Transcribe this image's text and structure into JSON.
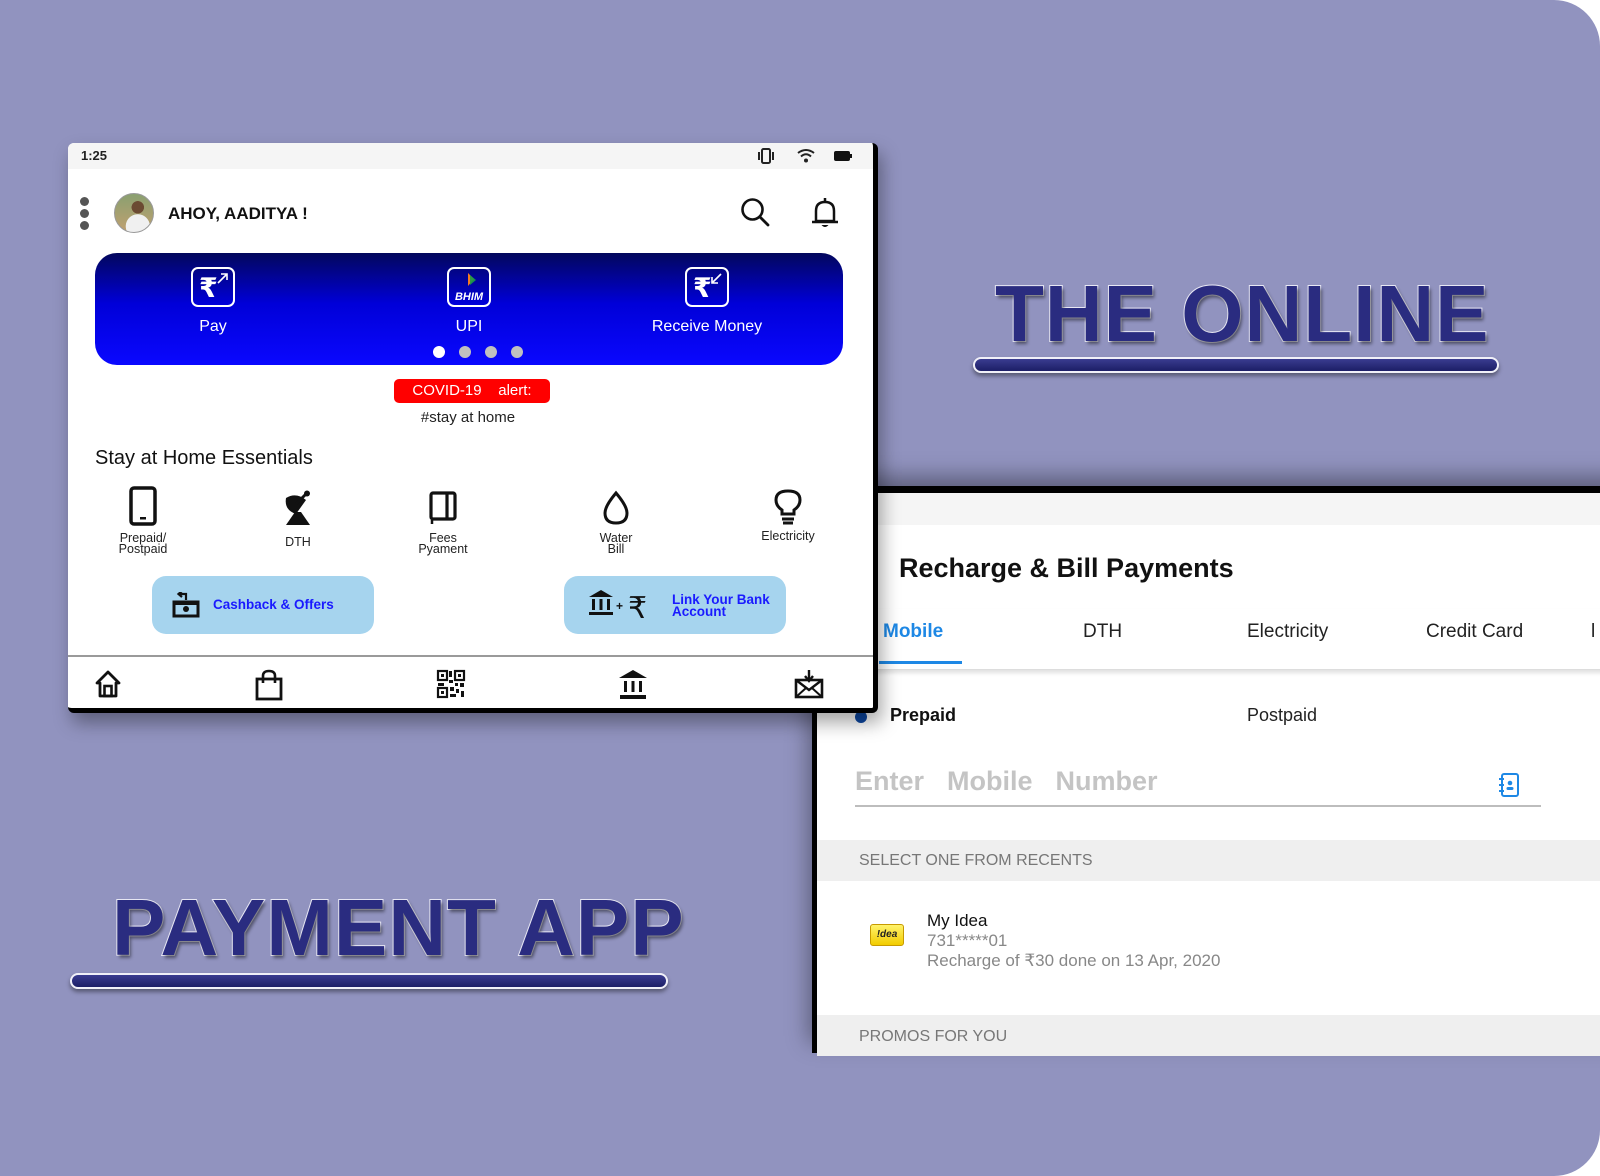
{
  "background": {
    "color": "#9193bf"
  },
  "titles": {
    "top": "THE ONLINE",
    "bottom": "PAYMENT APP",
    "text_color": "#2a2c80"
  },
  "home_screen": {
    "status_bar": {
      "time": "1:25",
      "icons": [
        "vibrate-icon",
        "wifi-icon",
        "battery-icon"
      ]
    },
    "header": {
      "greeting": "AHOY, AADITYA !",
      "icons": [
        "menu-icon",
        "search-icon",
        "bell-icon"
      ]
    },
    "banner": {
      "items": [
        {
          "label": "Pay",
          "icon": "rupee-send-icon"
        },
        {
          "label": "UPI",
          "icon": "bhim-icon",
          "icon_text": "BHIM"
        },
        {
          "label": "Receive Money",
          "icon": "rupee-receive-icon"
        }
      ],
      "page_count": 4,
      "active_page": 1
    },
    "alert": {
      "badge": "COVID-19    alert:",
      "subtext": "#stay at home",
      "color": "#ff0000"
    },
    "essentials": {
      "title": "Stay at Home Essentials",
      "items": [
        {
          "label_line1": "Prepaid/",
          "label_line2": "Postpaid"
        },
        {
          "label_line1": "DTH",
          "label_line2": ""
        },
        {
          "label_line1": "Fees",
          "label_line2": "Pyament"
        },
        {
          "label_line1": "Water",
          "label_line2": "Bill"
        },
        {
          "label_line1": "Electricity",
          "label_line2": ""
        }
      ]
    },
    "actions": {
      "cashback": "Cashback & Offers",
      "link_bank_line1": "Link Your Bank",
      "link_bank_line2": "Account",
      "plus": "+"
    },
    "bottom_nav": [
      "home",
      "shopping-bag",
      "qr-code",
      "bank",
      "inbox"
    ]
  },
  "recharge_screen": {
    "title": "Recharge & Bill Payments",
    "tabs": [
      {
        "label": "Mobile",
        "active": true
      },
      {
        "label": "DTH",
        "active": false
      },
      {
        "label": "Electricity",
        "active": false
      },
      {
        "label": "Credit Card",
        "active": false
      }
    ],
    "plan_type": {
      "options": [
        "Prepaid",
        "Postpaid"
      ],
      "selected": "Prepaid"
    },
    "mobile_input": {
      "placeholder": "Enter  Mobile  Number",
      "value": ""
    },
    "recents": {
      "header": "SELECT ONE FROM RECENTS",
      "items": [
        {
          "operator_logo": "idea",
          "logo_text": "!dea",
          "name": "My Idea",
          "number": "731*****01",
          "description": "Recharge of ₹30 done on 13 Apr, 2020"
        }
      ]
    },
    "promos_header": "PROMOS  FOR  YOU",
    "accent_color": "#1e88e5"
  }
}
